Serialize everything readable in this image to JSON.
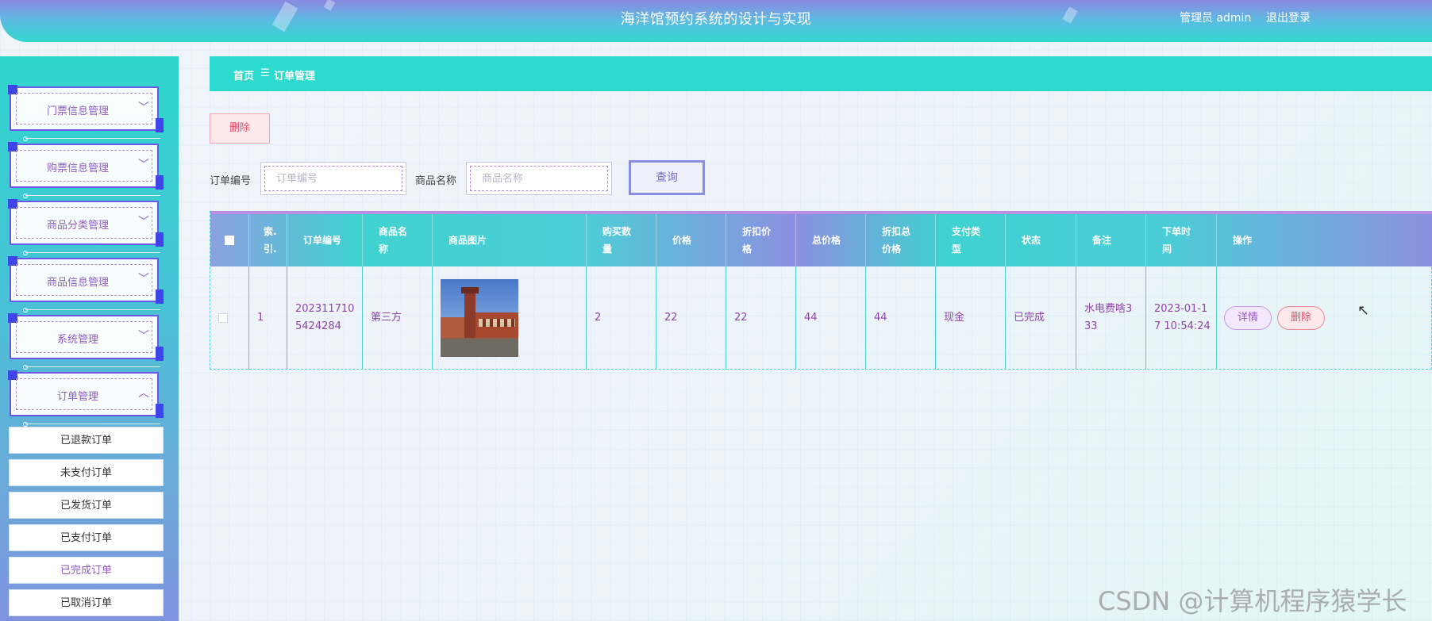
{
  "header": {
    "title": "海洋馆预约系统的设计与实现",
    "user": "管理员 admin",
    "logout": "退出登录"
  },
  "sidebar": {
    "menus": [
      {
        "label": "门票信息管理",
        "icon": "chevron-down-icon",
        "glyph": "﹀"
      },
      {
        "label": "购票信息管理",
        "icon": "chevron-down-icon",
        "glyph": "﹀"
      },
      {
        "label": "商品分类管理",
        "icon": "chevron-down-icon",
        "glyph": "﹀"
      },
      {
        "label": "商品信息管理",
        "icon": "chevron-down-icon",
        "glyph": "﹀"
      },
      {
        "label": "系统管理",
        "icon": "chevron-down-icon",
        "glyph": "﹀"
      },
      {
        "label": "订单管理",
        "icon": "chevron-up-icon",
        "glyph": "︿"
      }
    ],
    "submenu": [
      "已退款订单",
      "未支付订单",
      "已发货订单",
      "已支付订单",
      "已完成订单",
      "已取消订单"
    ],
    "active_sub": "已完成订单"
  },
  "breadcrumb": {
    "home": "首页",
    "separator": "☰",
    "current": "订单管理"
  },
  "toolbar": {
    "delete_label": "删除"
  },
  "search": {
    "order_no_label": "订单编号",
    "order_no_placeholder": "订单编号",
    "product_label": "商品名称",
    "product_placeholder": "商品名称",
    "query_label": "查询"
  },
  "table": {
    "headers": [
      "索引",
      "订单编号",
      "商品名称",
      "商品图片",
      "购买数量",
      "价格",
      "折扣价格",
      "总价格",
      "折扣总价格",
      "支付类型",
      "状态",
      "备注",
      "下单时间",
      "操作"
    ],
    "header_display": {
      "index": "索.\n引.",
      "order_no": "订单编号",
      "product": "商品名\n称",
      "image": "商品图片",
      "qty": "购买数\n量",
      "price": "价格",
      "discount_price": "折扣价\n格",
      "total": "总价格",
      "discount_total": "折扣总\n价格",
      "pay_type": "支付类\n型",
      "status": "状态",
      "remark": "备注",
      "time": "下单时\n间",
      "action": "操作"
    },
    "rows": [
      {
        "index": "1",
        "order_no": "2023117105424284",
        "order_no_wrapped": "202311710\n5424284",
        "product": "第三方",
        "qty": "2",
        "price": "22",
        "discount_price": "22",
        "total": "44",
        "discount_total": "44",
        "pay_type": "现金",
        "status": "已完成",
        "remark": "水电费啥333",
        "remark_wrapped": "水电费啥3\n33",
        "time": "2023-01-17 10:54:24",
        "time_wrapped": "2023-01-1\n7 10:54:24",
        "detail_label": "详情",
        "delete_label": "删除"
      }
    ]
  },
  "watermark": "CSDN @计算机程序猿学长",
  "colors": {
    "accent": "#2cdad0",
    "purple": "#8e44ad",
    "danger": "#e0506a"
  }
}
